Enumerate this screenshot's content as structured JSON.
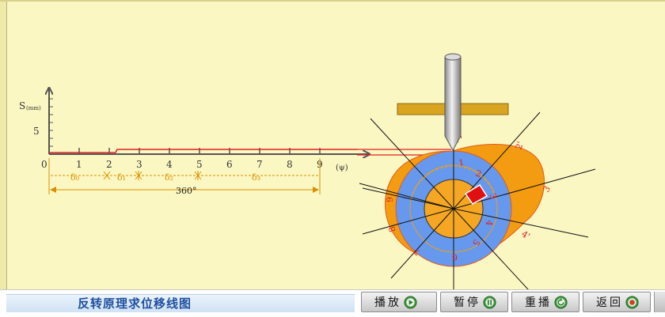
{
  "colors": {
    "background": "#fbf7c3",
    "axis": "#555555",
    "trace": "#e02020",
    "dimension": "#d89000",
    "cam_profile": "#f39c12",
    "base_circle_ring": "#6699ee",
    "hub": "#f5a623",
    "follower": "#c8c8c8",
    "guide": "#d9a520",
    "title": "#1f4f9e"
  },
  "graph": {
    "y_label_main": "S",
    "y_label_unit": "(mm)",
    "y_tick": "5",
    "x_ticks": [
      "0",
      "1",
      "2",
      "3",
      "4",
      "5",
      "6",
      "7",
      "8",
      "9"
    ],
    "x_axis_label": "(ψ)",
    "phase_labels": [
      "δ₀",
      "δ₁",
      "δ₂",
      "δ₃"
    ],
    "total_angle": "360°"
  },
  "cam": {
    "inner_labels": [
      "1",
      "2",
      "3",
      "4",
      "5",
      "6",
      "7",
      "8",
      "9"
    ],
    "outer_labels": [
      "1'",
      "2'",
      "3",
      "4'"
    ]
  },
  "footer": {
    "title": "反转原理求位移线图",
    "play_label": "播放",
    "pause_label": "暂停",
    "replay_label": "重播",
    "back_label": "返回"
  },
  "icons": {
    "play": "play-icon",
    "pause": "pause-icon",
    "replay": "replay-icon",
    "back": "back-icon"
  }
}
